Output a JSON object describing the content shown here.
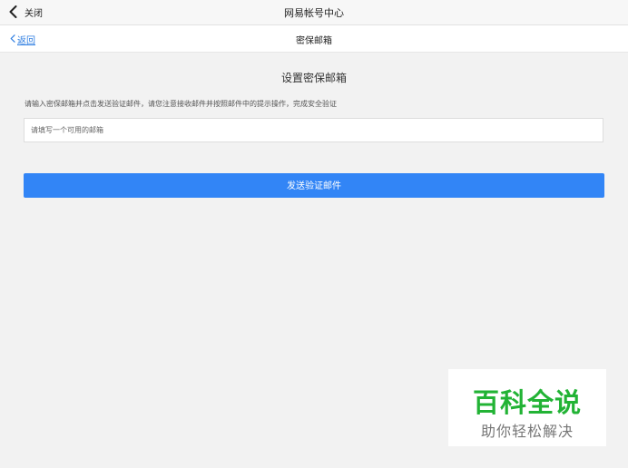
{
  "topbar": {
    "close_label": "关闭",
    "title": "网易帐号中心"
  },
  "subbar": {
    "back_label": "返回",
    "title": "密保邮箱"
  },
  "form": {
    "title": "设置密保邮箱",
    "instructions": "请输入密保邮箱并点击发送验证邮件，请您注意接收邮件并按照邮件中的提示操作，完成安全验证",
    "email_placeholder": "请填写一个可用的邮箱",
    "email_value": "",
    "send_button_label": "发送验证邮件"
  },
  "watermark": {
    "main": "百科全说",
    "sub": "助你轻松解决"
  },
  "colors": {
    "accent": "#3285f6",
    "link": "#2e7de1",
    "background": "#f2f2f2",
    "watermark_green": "#22b335"
  },
  "icons": {
    "close": "chevron-left-icon",
    "back": "chevron-left-icon"
  }
}
